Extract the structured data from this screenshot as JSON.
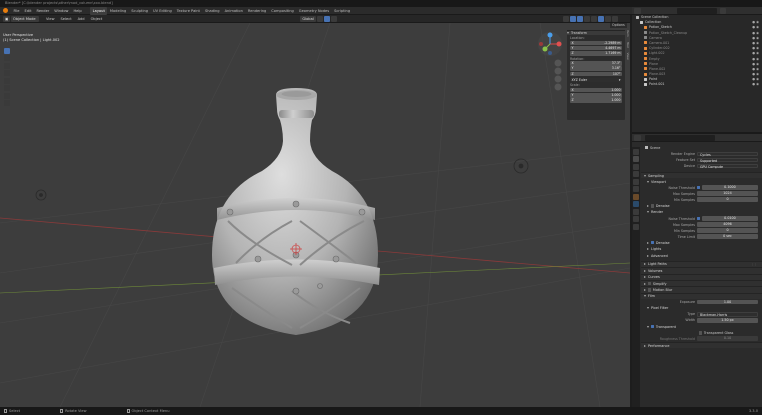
{
  "titlebar": {
    "text": "Blender* [C:\\blender projects\\other\\mod_column\\xxx.blend]"
  },
  "menubar": {
    "menus": [
      "File",
      "Edit",
      "Render",
      "Window",
      "Help"
    ],
    "workspaces": [
      "Layout",
      "Modeling",
      "Sculpting",
      "UV Editing",
      "Texture Paint",
      "Shading",
      "Animation",
      "Rendering",
      "Compositing",
      "Geometry Nodes",
      "Scripting"
    ],
    "scene": "Scene",
    "view_layer": "ViewLayer"
  },
  "viewport_header": {
    "mode": "Object Mode",
    "menus": [
      "View",
      "Select",
      "Add",
      "Object"
    ],
    "orientation": "Global",
    "options_label": "Options"
  },
  "viewport": {
    "view_name": "User Perspective",
    "collection_info": "(1) Scene Collection | Light.002"
  },
  "npanel": {
    "section": "Transform",
    "location_label": "Location:",
    "location": [
      {
        "axis": "X",
        "value": "-2.2989 m"
      },
      {
        "axis": "Y",
        "value": "4.4697 m"
      },
      {
        "axis": "Z",
        "value": "1.7169 m"
      }
    ],
    "rotation_label": "Rotation:",
    "rotation": [
      {
        "axis": "X",
        "value": "37.3°"
      },
      {
        "axis": "Y",
        "value": "3.16°"
      },
      {
        "axis": "Z",
        "value": "107°"
      }
    ],
    "rotation_mode": "XYZ Euler",
    "scale_label": "Scale:",
    "scale": [
      {
        "axis": "X",
        "value": "1.000"
      },
      {
        "axis": "Y",
        "value": "1.000"
      },
      {
        "axis": "Z",
        "value": "1.000"
      }
    ],
    "tabs": [
      "Item",
      "Tool",
      "View"
    ]
  },
  "outliner": {
    "root": "Scene Collection",
    "items": [
      {
        "name": "Collection",
        "color": "#c8c8c8"
      },
      {
        "name": "Potion_Sketch",
        "color": "#e88a3a"
      },
      {
        "name": "Potion_Sketch_Cleanup",
        "color": "#a0a0a0"
      },
      {
        "name": "Camera",
        "color": "#a0a0a0"
      },
      {
        "name": "Camera.001",
        "color": "#e88a3a"
      },
      {
        "name": "Cylinder.002",
        "color": "#e88a3a"
      },
      {
        "name": "Light.002",
        "color": "#e88a3a"
      },
      {
        "name": "Empty",
        "color": "#e88a3a"
      },
      {
        "name": "Plane",
        "color": "#e88a3a"
      },
      {
        "name": "Plane.002",
        "color": "#e88a3a"
      },
      {
        "name": "Plane.003",
        "color": "#e88a3a"
      },
      {
        "name": "Point",
        "color": "#c8c8c8"
      },
      {
        "name": "Point.001",
        "color": "#c8c8c8"
      }
    ]
  },
  "properties": {
    "scene_name": "Scene",
    "render_engine_label": "Render Engine",
    "render_engine": "Cycles",
    "feature_set_label": "Feature Set",
    "feature_set": "Supported",
    "device_label": "Device",
    "device": "GPU Compute",
    "sampling": "Sampling",
    "viewport": "Viewport",
    "noise_threshold_label": "Noise Threshold",
    "viewport_noise_threshold": "0.1000",
    "max_samples_label": "Max Samples",
    "viewport_max_samples": "1024",
    "min_samples_label": "Min Samples",
    "viewport_min_samples": "0",
    "denoise": "Denoise",
    "render": "Render",
    "render_noise_threshold": "0.0100",
    "render_max_samples": "4096",
    "render_min_samples": "0",
    "time_limit_label": "Time Limit",
    "time_limit": "0 sec",
    "render_denoise": "Denoise",
    "lights": "Lights",
    "advanced": "Advanced",
    "light_paths": "Light Paths",
    "volumes": "Volumes",
    "curves": "Curves",
    "simplify": "Simplify",
    "motion_blur": "Motion Blur",
    "film": "Film",
    "exposure_label": "Exposure",
    "exposure": "1.00",
    "pixel_filter": "Pixel Filter",
    "type_label": "Type",
    "type": "Blackman-Harris",
    "width_label": "Width",
    "width": "1.50 px",
    "transparent": "Transparent",
    "transparent_glass": "Transparent Glass",
    "roughness_threshold_label": "Roughness Threshold",
    "roughness_threshold": "0.10",
    "performance": "Performance"
  },
  "statusbar": {
    "select": "Select",
    "rotate": "Rotate View",
    "context": "Object Context Menu",
    "version": "3.3.0"
  },
  "colors": {
    "accent": "#4772b3",
    "brand": "#e87d0d",
    "viewport_bg": "#3d3d3d"
  }
}
